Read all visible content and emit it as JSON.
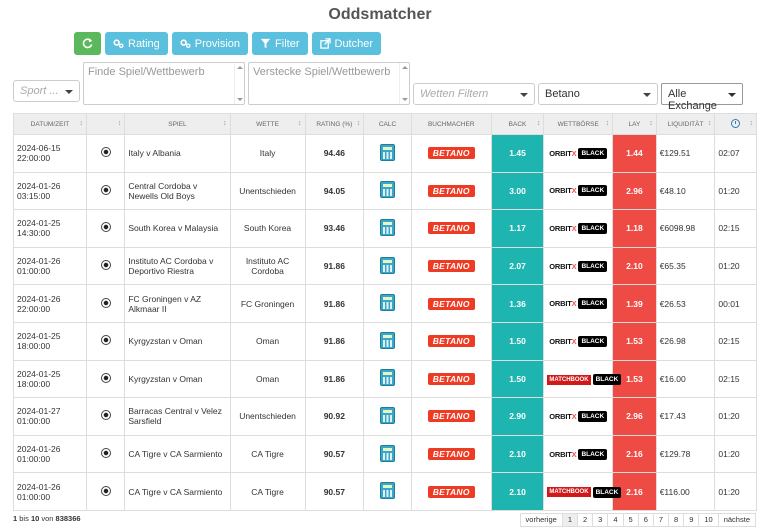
{
  "title": "Oddsmatcher",
  "toolbar": {
    "rating": "Rating",
    "provision": "Provision",
    "filter": "Filter",
    "dutcher": "Dutcher"
  },
  "filters": {
    "sport_placeholder": "Sport ...",
    "find_placeholder": "Finde Spiel/Wettbewerb",
    "hide_placeholder": "Verstecke Spiel/Wettbewerb",
    "bets_placeholder": "Wetten Filtern",
    "bookmaker": "Betano",
    "exchange": "Alle Exchange"
  },
  "columns": [
    "Datum/Zeit",
    "Spiel",
    "Wette",
    "Rating (%)",
    "Calc",
    "Buchmacher",
    "Back",
    "Wettbörse",
    "Lay",
    "Liquidität"
  ],
  "rows": [
    {
      "date": "2024-06-15",
      "time": "22:00:00",
      "game": "Italy v Albania",
      "bet": "Italy",
      "rating": "94.46",
      "back": "1.45",
      "exchange": "orbitx",
      "lay": "1.44",
      "liq": "€129.51",
      "remain": "02:07"
    },
    {
      "date": "2024-01-26",
      "time": "03:15:00",
      "game": "Central Cordoba v Newells Old Boys",
      "bet": "Unentschieden",
      "rating": "94.05",
      "back": "3.00",
      "exchange": "orbitx",
      "lay": "2.96",
      "liq": "€48.10",
      "remain": "01:20"
    },
    {
      "date": "2024-01-25",
      "time": "14:30:00",
      "game": "South Korea v Malaysia",
      "bet": "South Korea",
      "rating": "93.46",
      "back": "1.17",
      "exchange": "orbitx",
      "lay": "1.18",
      "liq": "€6098.98",
      "remain": "02:15"
    },
    {
      "date": "2024-01-26",
      "time": "01:00:00",
      "game": "Instituto AC Cordoba v Deportivo Riestra",
      "bet": "Instituto AC Cordoba",
      "rating": "91.86",
      "back": "2.07",
      "exchange": "orbitx",
      "lay": "2.10",
      "liq": "€65.35",
      "remain": "01:20"
    },
    {
      "date": "2024-01-26",
      "time": "22:00:00",
      "game": "FC Groningen v AZ Alkmaar II",
      "bet": "FC Groningen",
      "rating": "91.86",
      "back": "1.36",
      "exchange": "orbitx",
      "lay": "1.39",
      "liq": "€26.53",
      "remain": "00:01"
    },
    {
      "date": "2024-01-25",
      "time": "18:00:00",
      "game": "Kyrgyzstan v Oman",
      "bet": "Oman",
      "rating": "91.86",
      "back": "1.50",
      "exchange": "orbitx",
      "lay": "1.53",
      "liq": "€26.98",
      "remain": "02:15"
    },
    {
      "date": "2024-01-25",
      "time": "18:00:00",
      "game": "Kyrgyzstan v Oman",
      "bet": "Oman",
      "rating": "91.86",
      "back": "1.50",
      "exchange": "matchbook",
      "lay": "1.53",
      "liq": "€16.00",
      "remain": "02:15"
    },
    {
      "date": "2024-01-27",
      "time": "01:00:00",
      "game": "Barracas Central v Velez Sarsfield",
      "bet": "Unentschieden",
      "rating": "90.92",
      "back": "2.90",
      "exchange": "orbitx",
      "lay": "2.96",
      "liq": "€17.43",
      "remain": "01:20"
    },
    {
      "date": "2024-01-26",
      "time": "01:00:00",
      "game": "CA Tigre v CA Sarmiento",
      "bet": "CA Tigre",
      "rating": "90.57",
      "back": "2.10",
      "exchange": "orbitx",
      "lay": "2.16",
      "liq": "€129.78",
      "remain": "01:20"
    },
    {
      "date": "2024-01-26",
      "time": "01:00:00",
      "game": "CA Tigre v CA Sarmiento",
      "bet": "CA Tigre",
      "rating": "90.57",
      "back": "2.10",
      "exchange": "matchbook",
      "lay": "2.16",
      "liq": "€116.00",
      "remain": "01:20"
    }
  ],
  "bookmaker_label": "BETANO",
  "exchange_labels": {
    "orbitx_a": "ORBIT",
    "orbitx_b": "X",
    "matchbook": "MATCHBOOK",
    "black": "BLACK"
  },
  "footer": {
    "a": "1",
    "mid": " bis ",
    "b": "10",
    "of": " von ",
    "total": "838366"
  },
  "pager": [
    "vorherige",
    "1",
    "2",
    "3",
    "4",
    "5",
    "6",
    "7",
    "8",
    "9",
    "10",
    "nächste"
  ]
}
